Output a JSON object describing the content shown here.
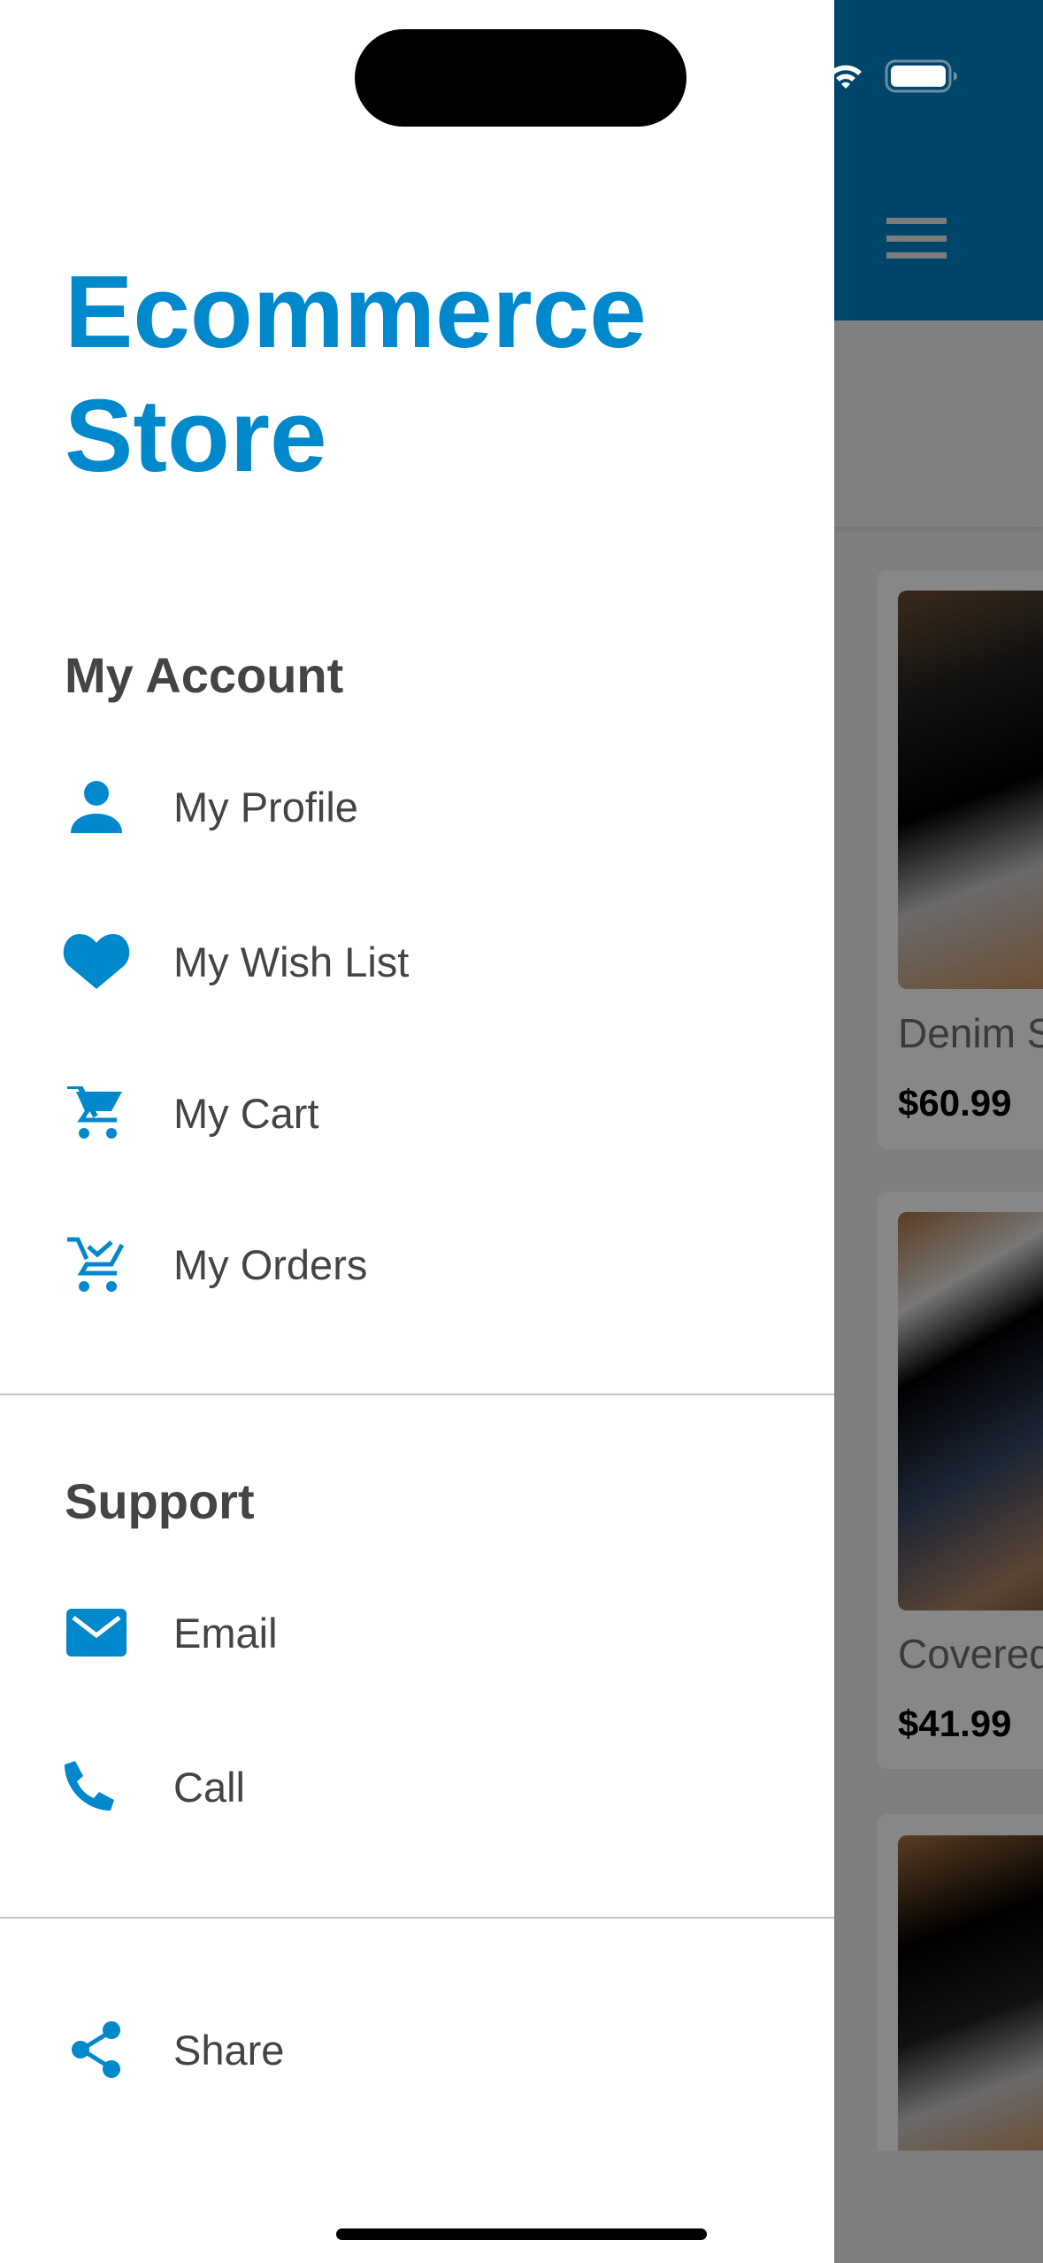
{
  "app_title": "Ecommerce Store",
  "drawer": {
    "title": "Ecommerce Store",
    "sections": [
      {
        "header": "My Account",
        "items": [
          {
            "label": "My Profile",
            "icon": "person-icon"
          },
          {
            "label": "My Wish List",
            "icon": "heart-icon"
          },
          {
            "label": "My Cart",
            "icon": "cart-icon"
          },
          {
            "label": "My Orders",
            "icon": "cart-check-icon"
          }
        ]
      },
      {
        "header": "Support",
        "items": [
          {
            "label": "Email",
            "icon": "envelope-icon"
          },
          {
            "label": "Call",
            "icon": "phone-icon"
          }
        ]
      },
      {
        "header": "",
        "items": [
          {
            "label": "Share",
            "icon": "share-icon"
          }
        ]
      }
    ]
  },
  "background": {
    "products": [
      {
        "name": "Denim S",
        "price": "$60.99"
      },
      {
        "name": "Covered",
        "price": "$41.99"
      },
      {
        "name": "",
        "price": ""
      }
    ]
  },
  "colors": {
    "accent": "#0088cc",
    "appbar": "#00466a",
    "text": "#444444"
  }
}
